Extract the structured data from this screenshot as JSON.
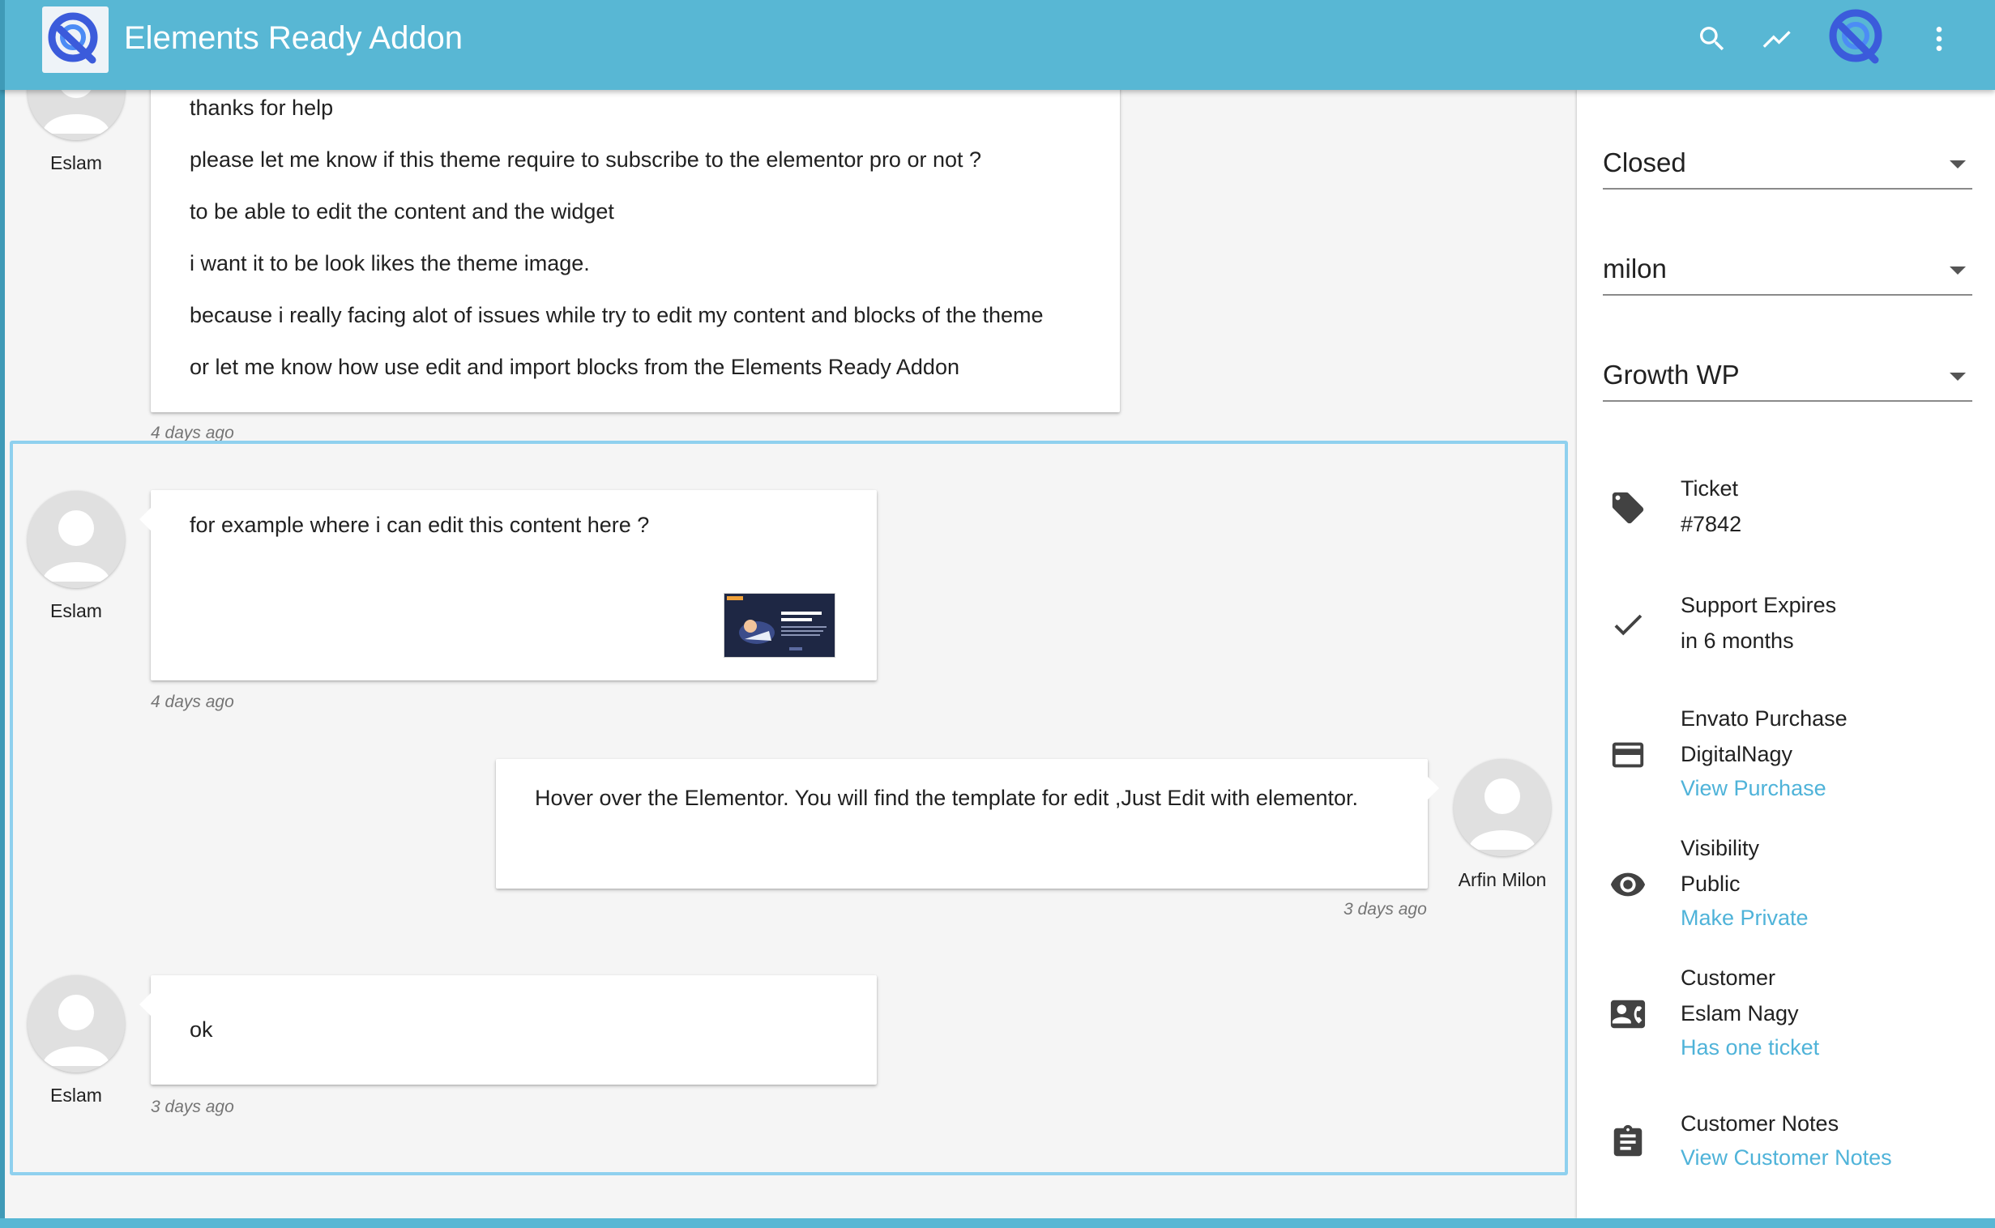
{
  "app": {
    "title": "Elements Ready Addon"
  },
  "toolbar": {
    "icons": [
      "search-icon",
      "trending-up-icon",
      "user-avatar-icon",
      "more-vert-icon"
    ]
  },
  "colors": {
    "appbar": "#58b7d4",
    "link": "#4fb3d9",
    "highlight_border": "#8fd0ee"
  },
  "conversation": {
    "messages": [
      {
        "author": "Eslam",
        "lines": [
          "thanks for help",
          "please let me know if this theme require to subscribe to the elementor pro or not ?",
          "to be able to edit the content and the widget",
          "i want it to be look likes the theme image.",
          "because i really facing alot of issues while try to edit my content and blocks of the theme",
          "or let me know how use edit and import blocks from the Elements Ready Addon"
        ],
        "time": "4 days ago"
      },
      {
        "author": "Eslam",
        "lines": [
          "for example where i can edit this content here ?"
        ],
        "attachment": "screenshot-thumbnail",
        "time": "4 days ago"
      },
      {
        "author": "Arfin Milon",
        "lines": [
          "Hover over the Elementor. You will find the template for edit ,Just Edit with elementor."
        ],
        "time": "3 days ago"
      },
      {
        "author": "Eslam",
        "lines": [
          "ok"
        ],
        "time": "3 days ago"
      }
    ]
  },
  "sidebar": {
    "status_select": {
      "value": "Closed"
    },
    "agent_select": {
      "value": "milon"
    },
    "product_select": {
      "value": "Growth WP"
    },
    "ticket": {
      "label": "Ticket",
      "value": "#7842",
      "icon": "tag-icon"
    },
    "support": {
      "label": "Support Expires",
      "value": "in 6 months",
      "icon": "check-icon"
    },
    "purchase": {
      "label": "Envato Purchase",
      "value": "DigitalNagy",
      "link": "View Purchase",
      "icon": "credit-card-icon"
    },
    "visibility": {
      "label": "Visibility",
      "value": "Public",
      "link": "Make Private",
      "icon": "eye-icon"
    },
    "customer": {
      "label": "Customer",
      "value": "Eslam Nagy",
      "link": "Has one ticket",
      "icon": "contact-card-icon"
    },
    "notes": {
      "label": "Customer Notes",
      "link": "View Customer Notes",
      "icon": "clipboard-icon"
    }
  }
}
